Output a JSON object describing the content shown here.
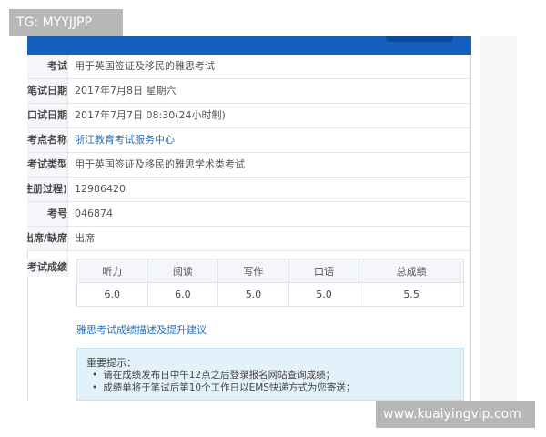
{
  "watermarks": {
    "top_left": "TG: MYYJJPP",
    "bottom_right": "www.kuaiyingvip.com"
  },
  "info_rows": [
    {
      "label": "考试",
      "value": "用于英国签证及移民的雅思考试"
    },
    {
      "label": "笔试日期",
      "value": "2017年7月8日 星期六"
    },
    {
      "label": "口试日期",
      "value": "2017年7月7日 08:30(24小时制)"
    },
    {
      "label": "考点名称",
      "value": "浙江教育考试服务中心"
    },
    {
      "label": "考试类型",
      "value": "用于英国签证及移民的雅思学术类考试"
    },
    {
      "label": "注册过程)",
      "value": "12986420"
    },
    {
      "label": "考号",
      "value": "046874"
    },
    {
      "label": "出席/缺席",
      "value": "出席"
    }
  ],
  "scores": {
    "label": "考试成绩",
    "headers": [
      "听力",
      "阅读",
      "写作",
      "口语",
      "总成绩"
    ],
    "values": [
      "6.0",
      "6.0",
      "5.0",
      "5.0",
      "5.5"
    ]
  },
  "description_link": "雅思考试成绩描述及提升建议",
  "notice": {
    "title": "重要提示：",
    "items": [
      "请在成绩发布日中午12点之后登录报名网站查询成绩；",
      "成绩单将于笔试后第10个工作日以EMS快递方式为您寄送；"
    ]
  },
  "colors": {
    "header_blue": "#1560bd",
    "link_blue": "#2a6fb5",
    "notice_bg": "#e3f1fb"
  }
}
